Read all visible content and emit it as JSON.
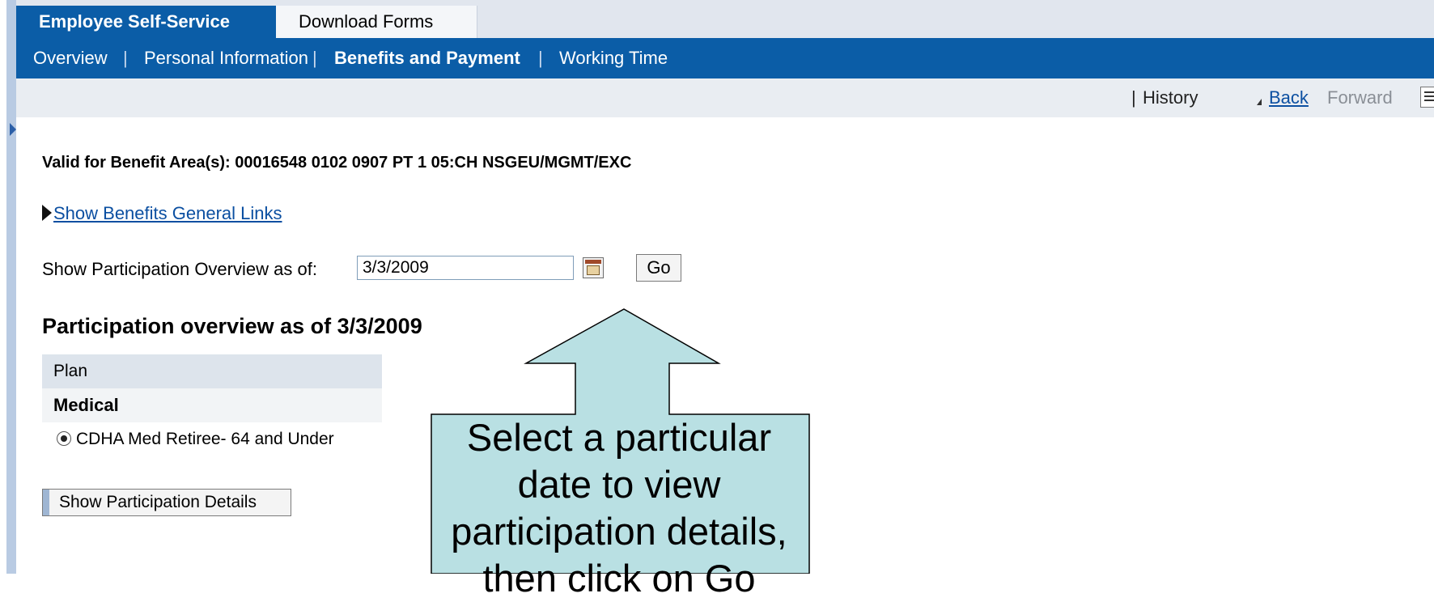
{
  "header": {
    "tabs": [
      {
        "label": "Employee Self-Service",
        "active": true
      },
      {
        "label": "Download Forms",
        "active": false
      }
    ],
    "sub_nav": [
      {
        "label": "Overview",
        "active": false
      },
      {
        "label": "Personal Information",
        "active": false
      },
      {
        "label": "Benefits and Payment",
        "active": true
      },
      {
        "label": "Working Time",
        "active": false
      }
    ],
    "separator": "|"
  },
  "toolbar": {
    "separator": "|",
    "history": "History",
    "back": "Back",
    "forward": "Forward",
    "menu_icon": "list-menu-icon"
  },
  "main": {
    "benefit_area": "Valid for Benefit Area(s): 00016548 0102 0907 PT 1 05:CH NSGEU/MGMT/EXC",
    "general_links": "Show Benefits General Links",
    "as_of_label": "Show Participation Overview as of:",
    "as_of_date": "3/3/2009",
    "go_label": "Go",
    "overview_title": "Participation overview as of 3/3/2009",
    "plan_table": {
      "header": "Plan",
      "group": "Medical",
      "rows": [
        {
          "label": "CDHA Med Retiree- 64 and Under",
          "selected": true
        }
      ]
    },
    "details_button": "Show Participation Details"
  },
  "callout": {
    "lines": [
      "Select a particular",
      "date to view",
      "participation details,",
      "then click on Go"
    ],
    "fill": "#b9e0e3",
    "stroke": "#000000"
  },
  "colors": {
    "header_blue": "#0b5da7",
    "link_blue": "#0b4fa1",
    "toolbar_bg": "#e9edf2"
  }
}
